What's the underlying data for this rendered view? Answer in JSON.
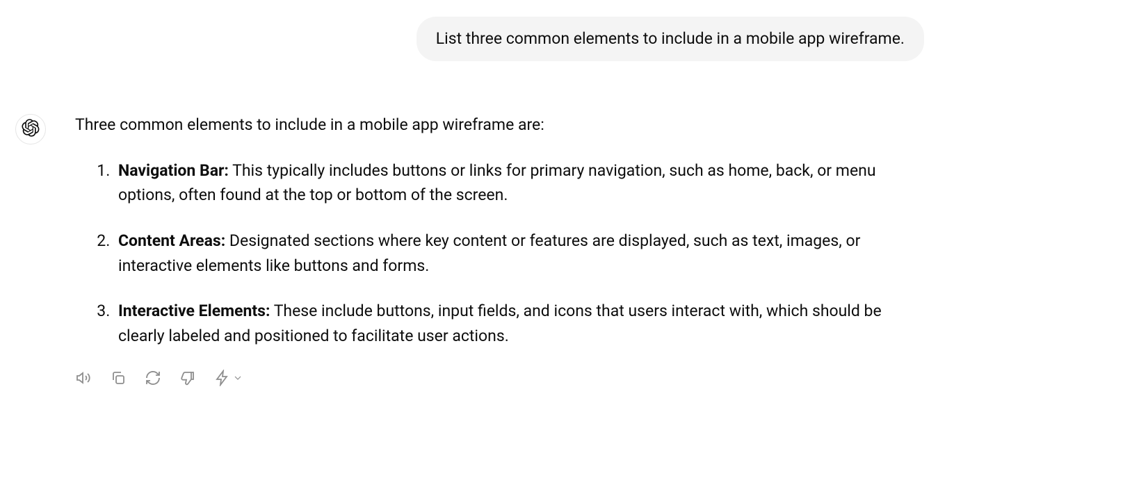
{
  "user": {
    "message": "List three common elements to include in a mobile app wireframe."
  },
  "assistant": {
    "intro": "Three common elements to include in a mobile app wireframe are:",
    "items": [
      {
        "title": "Navigation Bar:",
        "desc": " This typically includes buttons or links for primary navigation, such as home, back, or menu options, often found at the top or bottom of the screen."
      },
      {
        "title": "Content Areas:",
        "desc": " Designated sections where key content or features are displayed, such as text, images, or interactive elements like buttons and forms."
      },
      {
        "title": "Interactive Elements:",
        "desc": " These include buttons, input fields, and icons that users interact with, which should be clearly labeled and positioned to facilitate user actions."
      }
    ]
  },
  "icons": {
    "avatar": "openai-logo",
    "actions": [
      "read-aloud",
      "copy",
      "regenerate",
      "thumbs-down",
      "more"
    ]
  }
}
